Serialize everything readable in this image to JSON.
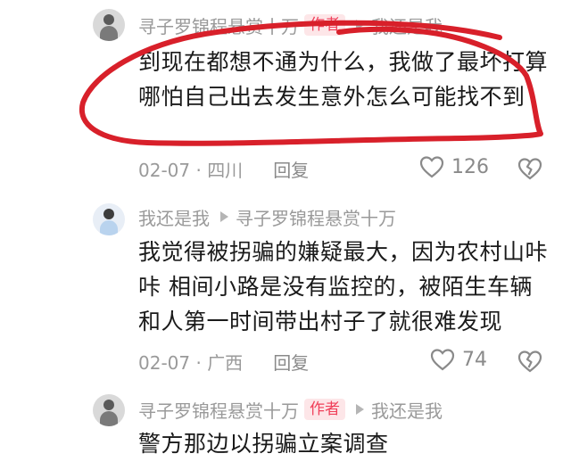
{
  "comments": [
    {
      "author": "寻子罗锦程悬赏十万",
      "badge": "作者",
      "reply_to": "我还是我",
      "text": "到现在都想不通为什么，我做了最坏打算哪怕自己出去发生意外怎么可能找不到",
      "date_location": "02-07 · 四川",
      "reply_label": "回复",
      "likes": "126"
    },
    {
      "author": "我还是我",
      "reply_to": "寻子罗锦程悬赏十万",
      "text": "我觉得被拐骗的嫌疑最大，因为农村山咔咔 相间小路是没有监控的，被陌生车辆和人第一时间带出村子了就很难发现",
      "date_location": "02-07 · 广西",
      "reply_label": "回复",
      "likes": "74"
    },
    {
      "author": "寻子罗锦程悬赏十万",
      "badge": "作者",
      "reply_to": "我还是我",
      "text": "警方那边以拐骗立案调查"
    }
  ],
  "icons": {
    "like": "heart-outline-icon",
    "dislike": "broken-heart-icon",
    "reply_arrow": "triangle-right-icon"
  },
  "colors": {
    "badge_text": "#f0405a",
    "badge_bg": "#fde6e8",
    "annotation_stroke": "#d8202a"
  }
}
